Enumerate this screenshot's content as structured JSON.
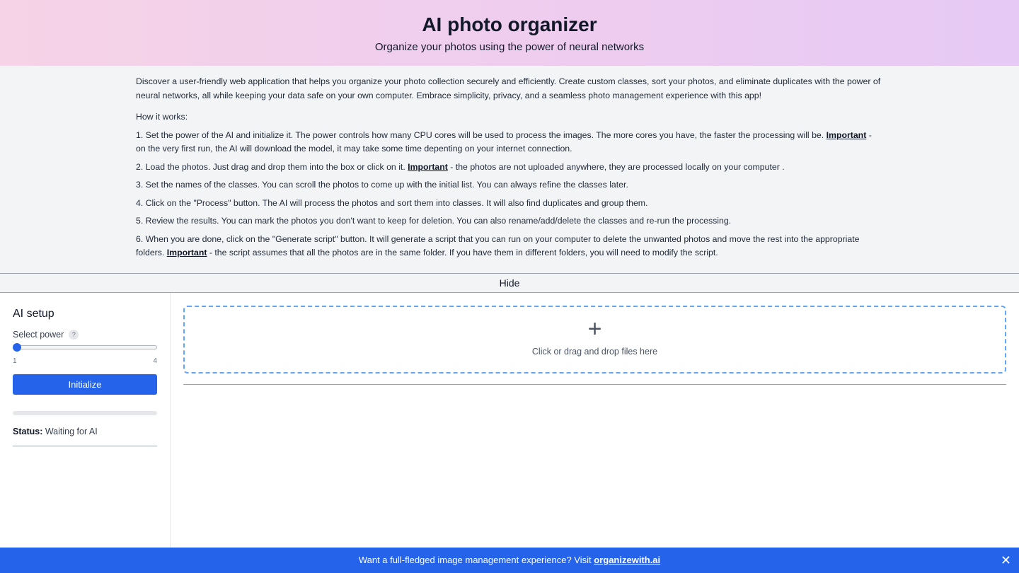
{
  "header": {
    "title": "AI photo organizer",
    "subtitle": "Organize your photos using the power of neural networks"
  },
  "info": {
    "intro": "Discover a user-friendly web application that helps you organize your photo collection securely and efficiently. Create custom classes, sort your photos, and eliminate duplicates with the power of neural networks, all while keeping your data safe on your own computer. Embrace simplicity, privacy, and a seamless photo management experience with this app!",
    "how_it_works": "How it works:",
    "steps": [
      {
        "before": "1. Set the power of the AI and initialize it. The power controls how many CPU cores will be used to process the images. The more cores you have, the faster the processing will be. ",
        "important": "Important",
        "after": " - on the very first run, the AI will download the model, it may take some time depenting on your internet connection."
      },
      {
        "before": "2. Load the photos. Just drag and drop them into the box or click on it. ",
        "important": "Important",
        "after": " - the photos are not uploaded anywhere, they are processed locally on your computer ."
      },
      {
        "before": "3. Set the names of the classes. You can scroll the photos to come up with the initial list. You can always refine the classes later.",
        "important": "",
        "after": ""
      },
      {
        "before": "4. Click on the \"Process\" button. The AI will process the photos and sort them into classes. It will also find duplicates and group them.",
        "important": "",
        "after": ""
      },
      {
        "before": "5. Review the results. You can mark the photos you don't want to keep for deletion. You can also rename/add/delete the classes and re-run the processing.",
        "important": "",
        "after": ""
      },
      {
        "before": "6. When you are done, click on the \"Generate script\" button. It will generate a script that you can run on your computer to delete the unwanted photos and move the rest into the appropriate folders. ",
        "important": "Important",
        "after": " - the script assumes that all the photos are in the same folder. If you have them in different folders, you will need to modify the script."
      }
    ]
  },
  "hide_label": "Hide",
  "sidebar": {
    "title": "AI setup",
    "power_label": "Select power",
    "help_icon": "?",
    "slider": {
      "min": "1",
      "max": "4",
      "value": 1
    },
    "init_button": "Initialize",
    "progress": 0,
    "status_label": "Status:",
    "status_value": " Waiting for AI"
  },
  "dropzone": {
    "plus": "+",
    "text": "Click or drag and drop files here"
  },
  "footer": {
    "text": "Want a full-fledged image management experience? Visit ",
    "link": "organizewith.ai",
    "close": "✕"
  },
  "colors": {
    "accent": "#2563eb",
    "dropzone_border": "#60a5fa"
  }
}
